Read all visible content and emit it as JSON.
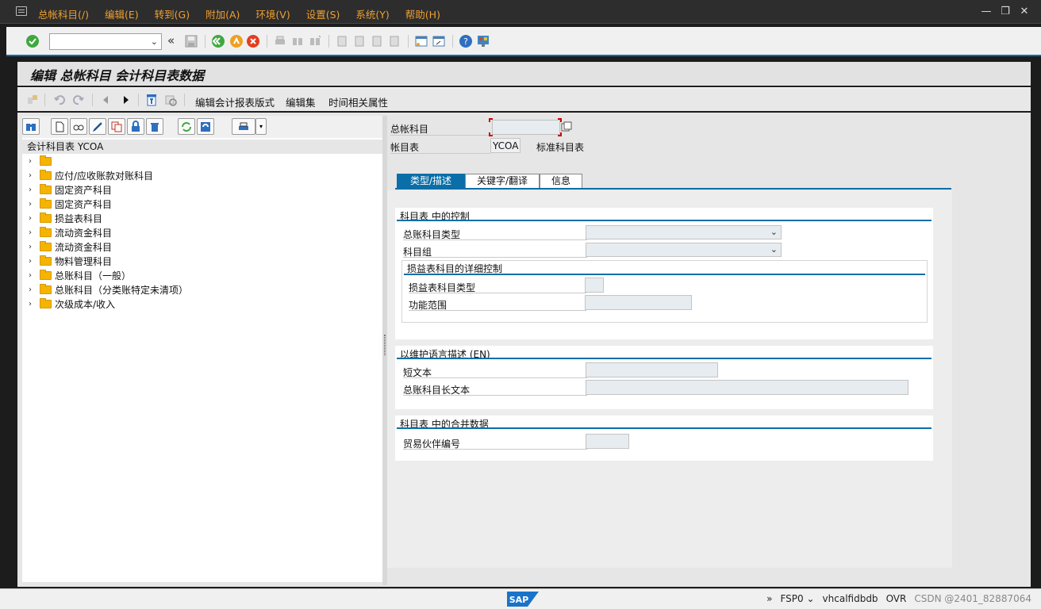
{
  "menubar": {
    "items": [
      "总帐科目(/)",
      "编辑(E)",
      "转到(G)",
      "附加(A)",
      "环境(V)",
      "设置(S)",
      "系统(Y)",
      "帮助(H)"
    ],
    "window_controls": [
      "—",
      "❐",
      "✕"
    ]
  },
  "toolbar": {
    "command_value": "",
    "back_arrows": "«"
  },
  "title": "编辑 总帐科目 会计科目表数据",
  "app_toolbar": {
    "buttons": [
      "编辑会计报表版式",
      "编辑集",
      "时间相关属性"
    ]
  },
  "tree": {
    "header": "会计科目表 YCOA",
    "items": [
      "",
      "应付/应收账款对账科目",
      "固定资产科目",
      "固定资产科目",
      "损益表科目",
      "流动资金科目",
      "流动资金科目",
      "物料管理科目",
      "总账科目（一般）",
      "总账科目（分类账特定未清项）",
      "次级成本/收入"
    ]
  },
  "header_fields": {
    "gl_account_label": "总帐科目",
    "gl_account_value": "",
    "coa_label": "帐目表",
    "coa_value": "YCOA",
    "coa_desc": "标准科目表"
  },
  "tabs": [
    "类型/描述",
    "关键字/翻译",
    "信息"
  ],
  "control_group": {
    "title": "科目表    中的控制",
    "account_type_label": "总账科目类型",
    "account_type_value": "",
    "account_group_label": "科目组",
    "account_group_value": "",
    "sub_title": "损益表科目的详细控制",
    "pl_type_label": "损益表科目类型",
    "functional_area_label": "功能范围"
  },
  "desc_group": {
    "title": "以维护语言描述 (EN)",
    "short_text_label": "短文本",
    "long_text_label": "总账科目长文本"
  },
  "consol_group": {
    "title": "科目表    中的合并数据",
    "trading_partner_label": "贸易伙伴编号"
  },
  "statusbar": {
    "logo": "SAP",
    "items": [
      "»",
      "FSP0 ⌄",
      "vhcalfidbdb",
      "OVR",
      "CSDN @2401_82887064"
    ]
  },
  "colors": {
    "accent": "#0a6ea8",
    "menu_text": "#f0a030",
    "folder": "#f4b400"
  }
}
